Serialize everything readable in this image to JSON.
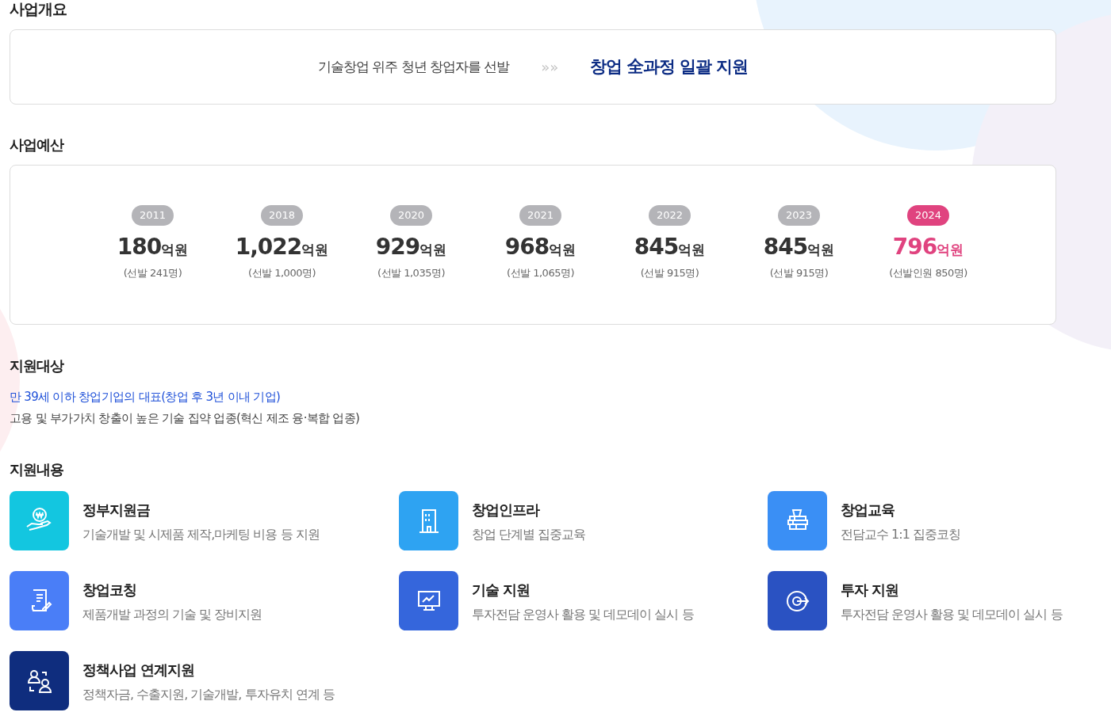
{
  "overview": {
    "heading": "사업개요",
    "left_text": "기술창업 위주 청년 창업자를 선발",
    "arrow": "»»",
    "right_text": "창업 全과정 일괄 지원"
  },
  "budget": {
    "heading": "사업예산",
    "years": [
      {
        "year": "2011",
        "amount": "180",
        "unit": "억원",
        "note": "(선발 241명)",
        "highlight": false
      },
      {
        "year": "2018",
        "amount": "1,022",
        "unit": "억원",
        "note": "(선발 1,000명)",
        "highlight": false
      },
      {
        "year": "2020",
        "amount": "929",
        "unit": "억원",
        "note": "(선발 1,035명)",
        "highlight": false
      },
      {
        "year": "2021",
        "amount": "968",
        "unit": "억원",
        "note": "(선발 1,065명)",
        "highlight": false
      },
      {
        "year": "2022",
        "amount": "845",
        "unit": "억원",
        "note": "(선발 915명)",
        "highlight": false
      },
      {
        "year": "2023",
        "amount": "845",
        "unit": "억원",
        "note": "(선발 915명)",
        "highlight": false
      },
      {
        "year": "2024",
        "amount": "796",
        "unit": "억원",
        "note": "(선발인원 850명)",
        "highlight": true
      }
    ]
  },
  "target": {
    "heading": "지원대상",
    "lines": [
      {
        "text": "만 39세 이하 창업기업의 대표(창업 후 3년 이내 기업)",
        "emphasis": true
      },
      {
        "text": "고용 및 부가가치 창출이 높은 기술 집약 업종(혁신 제조 융·복합 업종)",
        "emphasis": false
      }
    ]
  },
  "support": {
    "heading": "지원내용",
    "items": [
      {
        "title": "정부지원금",
        "desc": "기술개발 및 시제품 제작,마케팅 비용 등 지원",
        "color": "#13c6e0"
      },
      {
        "title": "창업인프라",
        "desc": "창업 단계별 집중교육",
        "color": "#2ea3f2"
      },
      {
        "title": "창업교육",
        "desc": "전담교수 1:1 집중코칭",
        "color": "#3a8ff5"
      },
      {
        "title": "창업코칭",
        "desc": "제품개발 과정의 기술 및 장비지원",
        "color": "#4a7ef7"
      },
      {
        "title": "기술 지원",
        "desc": "투자전담 운영사 활용 및 데모데이 실시 등",
        "color": "#3566dc"
      },
      {
        "title": "투자 지원",
        "desc": "투자전담 운영사 활용  및 데모데이 실시 등",
        "color": "#2a52c2"
      },
      {
        "title": "정책사업 연계지원",
        "desc": "정책자금, 수출지원, 기술개발, 투자유치 연계 등",
        "color": "#0f2d7e"
      }
    ]
  }
}
